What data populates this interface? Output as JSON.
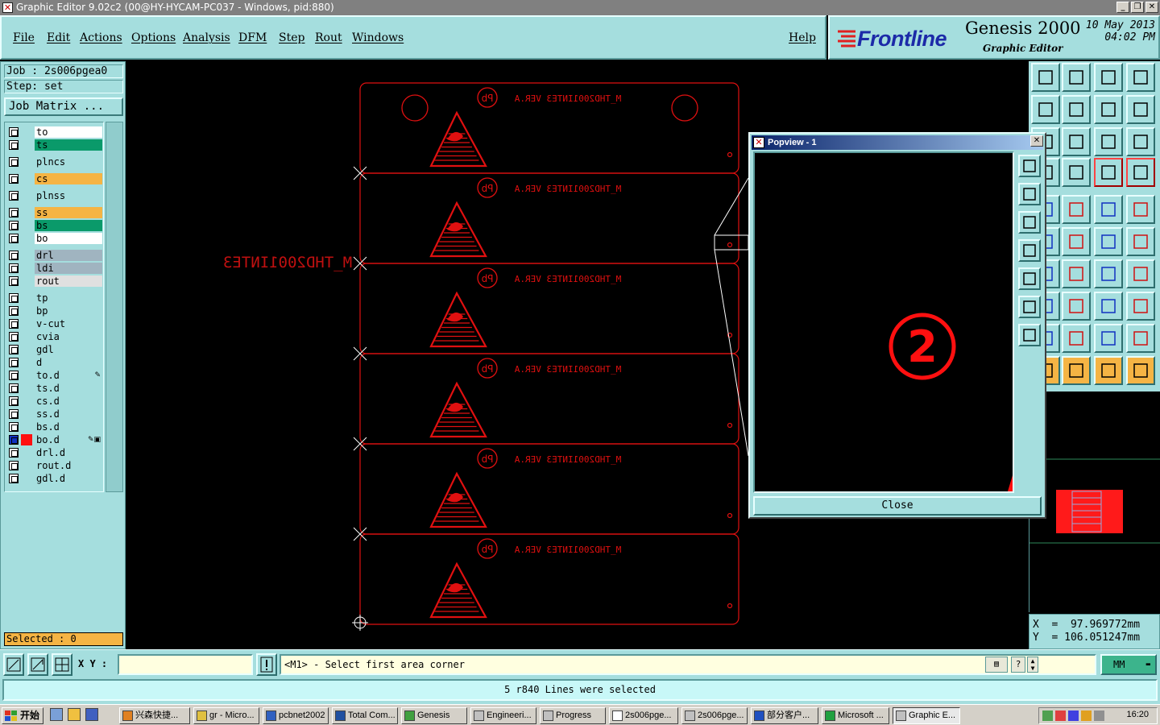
{
  "window": {
    "title": "Graphic Editor 9.02c2 (00@HY-HYCAM-PC037 - Windows, pid:880)"
  },
  "menu": [
    {
      "label": "File"
    },
    {
      "label": "Edit"
    },
    {
      "label": "Actions"
    },
    {
      "label": "Options"
    },
    {
      "label": "Analysis"
    },
    {
      "label": "DFM"
    },
    {
      "label": "Step"
    },
    {
      "label": "Rout"
    },
    {
      "label": "Windows"
    },
    {
      "label": "Help"
    }
  ],
  "brand": {
    "logo": "Frontline",
    "product": "Genesis 2000",
    "subtitle": "Graphic Editor",
    "date": "10 May 2013",
    "time": "04:02 PM"
  },
  "job": {
    "job_line": "Job : 2s006pgea0",
    "step_line": "Step: set",
    "matrix_button": "Job Matrix ..."
  },
  "layers": [
    {
      "name": "to",
      "color": "#ffffff"
    },
    {
      "name": "ts",
      "color": "#0a9a6a"
    },
    {
      "name": "plncs",
      "color": "#a5dede"
    },
    {
      "name": "cs",
      "color": "#f5b444"
    },
    {
      "name": "plnss",
      "color": "#a5dede"
    },
    {
      "name": "ss",
      "color": "#f5b444"
    },
    {
      "name": "bs",
      "color": "#0a9a6a"
    },
    {
      "name": "bo",
      "color": "#ffffff"
    },
    {
      "name": "drl",
      "color": "#a0b4c0"
    },
    {
      "name": "ldi",
      "color": "#a0b4c0"
    },
    {
      "name": "rout",
      "color": "#e0e0e0"
    },
    {
      "name": "tp",
      "color": "#a5dede"
    },
    {
      "name": "bp",
      "color": "#a5dede"
    },
    {
      "name": "v-cut",
      "color": "#a5dede"
    },
    {
      "name": "cvia",
      "color": "#a5dede"
    },
    {
      "name": "gdl",
      "color": "#a5dede"
    },
    {
      "name": "d",
      "color": "#a5dede"
    },
    {
      "name": "to.d",
      "color": "#a5dede",
      "marker": "✎"
    },
    {
      "name": "ts.d",
      "color": "#a5dede"
    },
    {
      "name": "cs.d",
      "color": "#a5dede"
    },
    {
      "name": "ss.d",
      "color": "#a5dede"
    },
    {
      "name": "bs.d",
      "color": "#a5dede"
    },
    {
      "name": "bo.d",
      "color": "#a5dede",
      "marker": "✎▣",
      "active": true
    },
    {
      "name": "drl.d",
      "color": "#a5dede"
    },
    {
      "name": "rout.d",
      "color": "#a5dede"
    },
    {
      "name": "gdl.d",
      "color": "#a5dede"
    }
  ],
  "selected": "Selected : 0",
  "canvas": {
    "panel_text": "M_THD2001INTE3 VER.A",
    "side_text": "M_THD2001INTE3",
    "pb_label": "Pb",
    "panel_count": 6,
    "colors": {
      "feature": "#e01010",
      "background": "#000000"
    }
  },
  "popview": {
    "title": "Popview - 1",
    "close_label": "Close",
    "marker": "2"
  },
  "coords": {
    "x": "X  =  97.969772mm",
    "y": "Y  = 106.051247mm"
  },
  "command": {
    "xy_label": "X Y :",
    "xy_value": "",
    "prompt": "<M1> - Select first area corner",
    "units": "MM",
    "message": "5 r840 Lines were selected"
  },
  "taskbar": {
    "start": "开始",
    "tasks": [
      {
        "label": "兴森快捷..."
      },
      {
        "label": "gr - Micro..."
      },
      {
        "label": "pcbnet2002"
      },
      {
        "label": "Total Com..."
      },
      {
        "label": "Genesis"
      },
      {
        "label": "Engineeri..."
      },
      {
        "label": "Progress"
      },
      {
        "label": "2s006pge..."
      },
      {
        "label": "2s006pge..."
      },
      {
        "label": "部分客户..."
      },
      {
        "label": "Microsoft ..."
      },
      {
        "label": "Graphic E...",
        "active": true
      }
    ],
    "clock": "16:20"
  }
}
